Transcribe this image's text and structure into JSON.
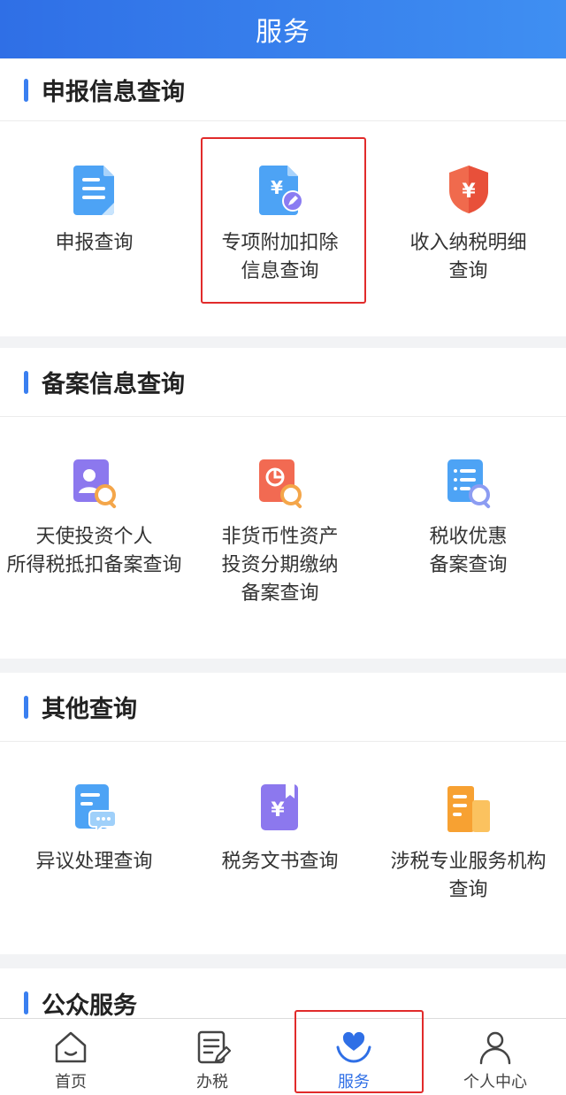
{
  "header": {
    "title": "服务"
  },
  "sections": [
    {
      "title": "申报信息查询",
      "items": [
        {
          "label": "申报查询",
          "icon": "document-icon"
        },
        {
          "label": "专项附加扣除\n信息查询",
          "icon": "yuan-document-edit-icon"
        },
        {
          "label": "收入纳税明细\n查询",
          "icon": "yuan-shield-icon"
        }
      ]
    },
    {
      "title": "备案信息查询",
      "items": [
        {
          "label": "天使投资个人\n所得税抵扣备案查询",
          "icon": "person-search-icon"
        },
        {
          "label": "非货币性资产\n投资分期缴纳\n备案查询",
          "icon": "pie-chart-search-icon"
        },
        {
          "label": "税收优惠\n备案查询",
          "icon": "list-search-icon"
        }
      ]
    },
    {
      "title": "其他查询",
      "items": [
        {
          "label": "异议处理查询",
          "icon": "message-document-icon"
        },
        {
          "label": "税务文书查询",
          "icon": "yuan-book-icon"
        },
        {
          "label": "涉税专业服务机构\n查询",
          "icon": "building-icon"
        }
      ]
    },
    {
      "title": "公众服务"
    }
  ],
  "tabs": [
    {
      "label": "首页",
      "icon": "home-icon"
    },
    {
      "label": "办税",
      "icon": "edit-list-icon"
    },
    {
      "label": "服务",
      "icon": "heart-hands-icon",
      "active": true
    },
    {
      "label": "个人中心",
      "icon": "user-icon"
    }
  ],
  "colors": {
    "accent": "#2f6fe6",
    "highlight": "#e12b2b"
  }
}
